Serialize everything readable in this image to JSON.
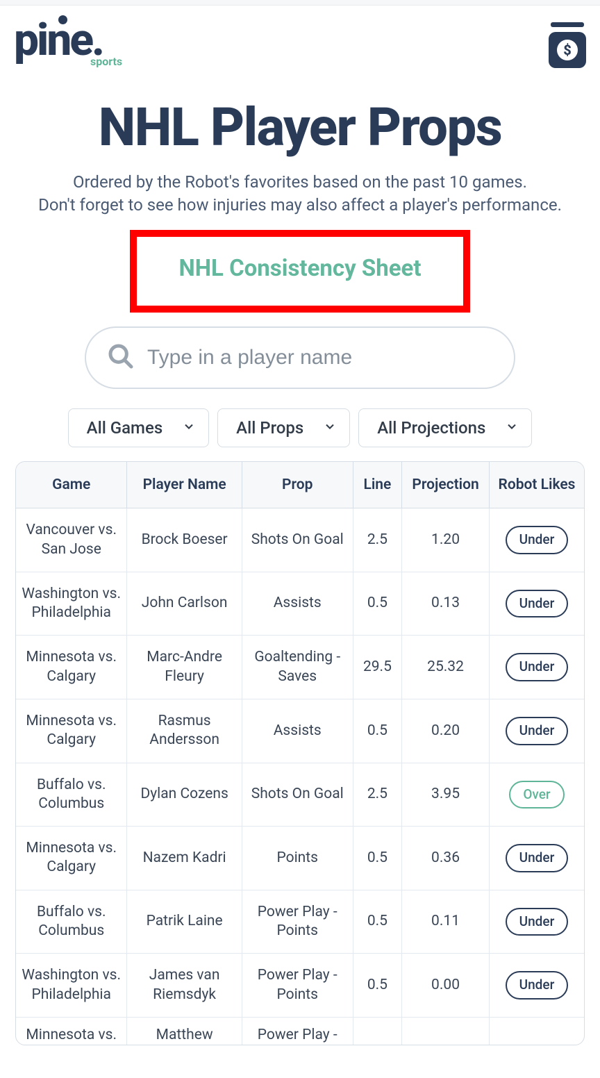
{
  "header": {
    "logo_main": "pine.",
    "logo_sub": "sports"
  },
  "page": {
    "title": "NHL Player Props",
    "subtitle_line1": "Ordered by the Robot's favorites based on the past 10 games.",
    "subtitle_line2": "Don't forget to see how injuries may also affect a player's performance.",
    "consistency_link": "NHL Consistency Sheet"
  },
  "search": {
    "placeholder": "Type in a player name"
  },
  "filters": {
    "games": "All Games",
    "props": "All Props",
    "projections": "All Projections"
  },
  "table": {
    "headers": {
      "game": "Game",
      "player": "Player Name",
      "prop": "Prop",
      "line": "Line",
      "projection": "Projection",
      "likes": "Robot Likes"
    },
    "rows": [
      {
        "game": "Vancouver vs. San Jose",
        "player": "Brock Boeser",
        "prop": "Shots On Goal",
        "line": "2.5",
        "projection": "1.20",
        "likes": "Under",
        "likes_type": "under"
      },
      {
        "game": "Washington vs. Philadelphia",
        "player": "John Carlson",
        "prop": "Assists",
        "line": "0.5",
        "projection": "0.13",
        "likes": "Under",
        "likes_type": "under"
      },
      {
        "game": "Minnesota vs. Calgary",
        "player": "Marc-Andre Fleury",
        "prop": "Goaltending - Saves",
        "line": "29.5",
        "projection": "25.32",
        "likes": "Under",
        "likes_type": "under"
      },
      {
        "game": "Minnesota vs. Calgary",
        "player": "Rasmus Andersson",
        "prop": "Assists",
        "line": "0.5",
        "projection": "0.20",
        "likes": "Under",
        "likes_type": "under"
      },
      {
        "game": "Buffalo vs. Columbus",
        "player": "Dylan Cozens",
        "prop": "Shots On Goal",
        "line": "2.5",
        "projection": "3.95",
        "likes": "Over",
        "likes_type": "over"
      },
      {
        "game": "Minnesota vs. Calgary",
        "player": "Nazem Kadri",
        "prop": "Points",
        "line": "0.5",
        "projection": "0.36",
        "likes": "Under",
        "likes_type": "under"
      },
      {
        "game": "Buffalo vs. Columbus",
        "player": "Patrik Laine",
        "prop": "Power Play - Points",
        "line": "0.5",
        "projection": "0.11",
        "likes": "Under",
        "likes_type": "under"
      },
      {
        "game": "Washington vs. Philadelphia",
        "player": "James van Riemsdyk",
        "prop": "Power Play - Points",
        "line": "0.5",
        "projection": "0.00",
        "likes": "Under",
        "likes_type": "under"
      }
    ],
    "partial_row": {
      "game": "Minnesota vs.",
      "player": "Matthew",
      "prop": "Power Play -"
    }
  }
}
